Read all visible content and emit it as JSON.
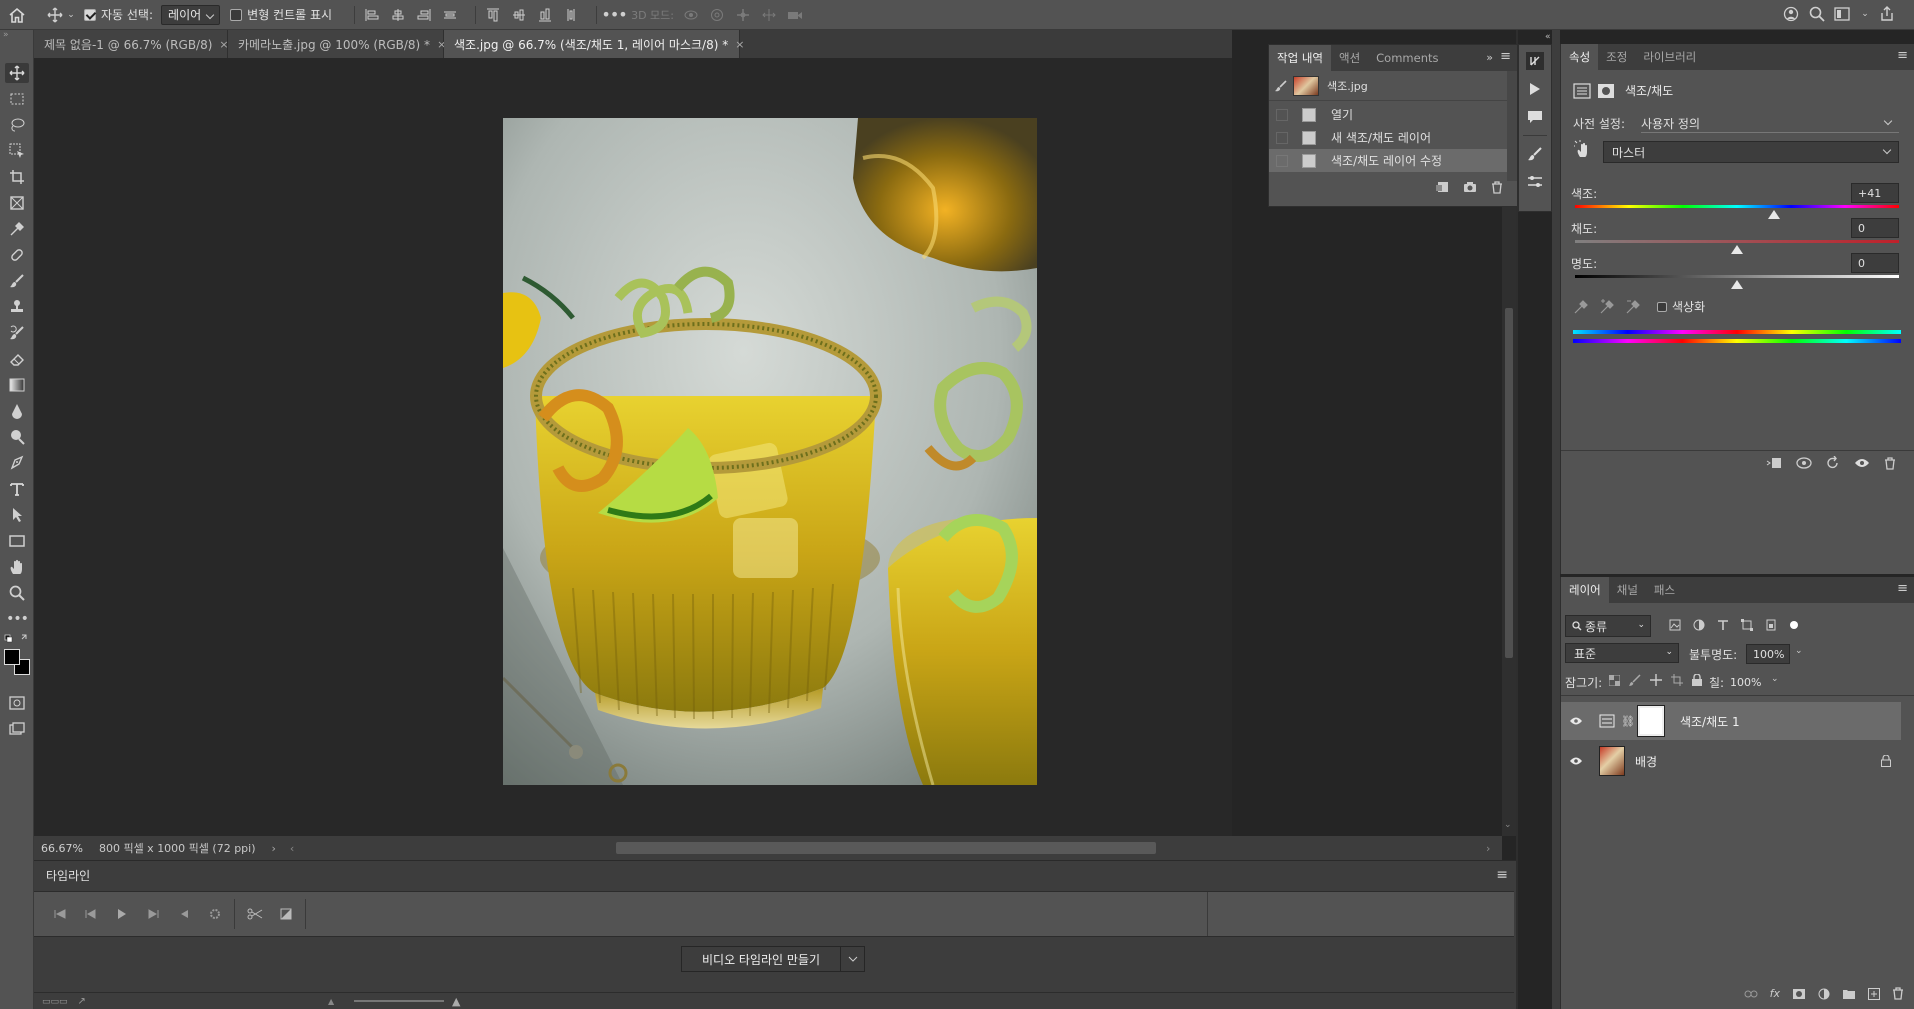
{
  "options_bar": {
    "auto_select_label": "자동 선택:",
    "auto_select_checked": true,
    "auto_select_target": "레이어",
    "transform_controls_label": "변형 컨트롤 표시",
    "transform_controls_checked": false,
    "mode_3d_label": "3D 모드:"
  },
  "tabs": [
    {
      "label": "제목 없음-1 @ 66.7% (RGB/8)",
      "close": "×",
      "active": false
    },
    {
      "label": "카메라노출.jpg @ 100% (RGB/8) *",
      "close": "×",
      "active": false
    },
    {
      "label": "색조.jpg @ 66.7% (색조/채도 1, 레이어 마스크/8) *",
      "close": "×",
      "active": true
    }
  ],
  "status_bar": {
    "zoom": "66.67%",
    "doc_info": "800 픽셀 x 1000 픽셀 (72 ppi)"
  },
  "timeline": {
    "title": "타임라인",
    "create_button": "비디오 타임라인 만들기"
  },
  "history_panel": {
    "tabs": [
      "작업 내역",
      "액션",
      "Comments"
    ],
    "snapshot": "색조.jpg",
    "items": [
      "열기",
      "새 색조/채도 레이어",
      "색조/채도 레이어 수정"
    ],
    "selected_index": 2
  },
  "properties_panel": {
    "tabs": [
      "속성",
      "조정",
      "라이브러리"
    ],
    "title": "색조/채도",
    "preset_label": "사전 설정:",
    "preset_value": "사용자 정의",
    "channel_value": "마스터",
    "hue_label": "색조:",
    "hue_value": "+41",
    "hue_amount": 41,
    "saturation_label": "채도:",
    "saturation_value": "0",
    "saturation_amount": 0,
    "lightness_label": "명도:",
    "lightness_value": "0",
    "lightness_amount": 0,
    "colorize_label": "색상화",
    "colorize_checked": false
  },
  "layers_panel": {
    "tabs": [
      "레이어",
      "채널",
      "패스"
    ],
    "filter_label": "종류",
    "blend_mode": "표준",
    "opacity_label": "불투명도:",
    "opacity_value": "100%",
    "lock_label": "잠그기:",
    "fill_label": "칠:",
    "fill_value": "100%",
    "layers": [
      {
        "name": "색조/채도 1",
        "type": "adjustment",
        "visible": true,
        "selected": true
      },
      {
        "name": "배경",
        "type": "image",
        "visible": true,
        "locked": true
      }
    ]
  },
  "colors": {
    "panel_bg": "#535353",
    "dark_bg": "#3d3d3d",
    "canvas_bg": "#282828"
  }
}
